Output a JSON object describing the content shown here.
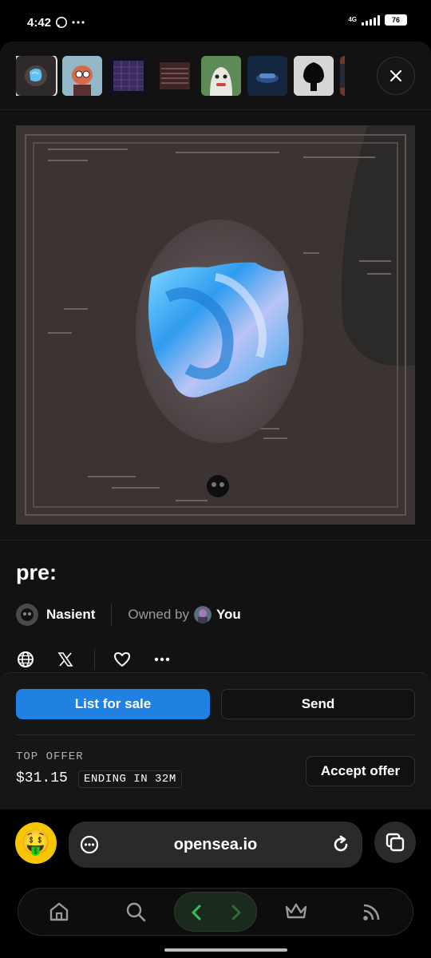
{
  "status_bar": {
    "time": "4:42",
    "extra": "•••",
    "network": "4G",
    "battery": "76"
  },
  "thumbnails": [
    {
      "name": "thumb-pre-cube",
      "active": true,
      "color": "#2e2a2a"
    },
    {
      "name": "thumb-cartoon-pig",
      "active": false,
      "color": "#93b9c9"
    },
    {
      "name": "thumb-purple-grid",
      "active": false,
      "color": "#1c1530"
    },
    {
      "name": "thumb-red-lines",
      "active": false,
      "color": "#1a1414"
    },
    {
      "name": "thumb-green-face",
      "active": false,
      "color": "#5d8a55"
    },
    {
      "name": "thumb-blue-car",
      "active": false,
      "color": "#1b3050"
    },
    {
      "name": "thumb-black-tree",
      "active": false,
      "color": "#d6d6d6"
    },
    {
      "name": "thumb-partial",
      "active": false,
      "color": "#6b3b2b"
    }
  ],
  "nft": {
    "title": "pre:",
    "creator": "Nasient",
    "owned_by_label": "Owned by",
    "owner": "You"
  },
  "actions": {
    "list_for_sale": "List for sale",
    "send": "Send",
    "top_offer_label": "TOP OFFER",
    "top_offer_price": "$31.15",
    "ending": "ENDING IN 32M",
    "accept_offer": "Accept offer"
  },
  "browser": {
    "url": "opensea.io",
    "emoji": "🤑"
  },
  "colors": {
    "accent_blue": "#2081e2",
    "sheet_bg": "#121212",
    "emoji_bg": "#f6c700"
  },
  "icons": [
    "globe-icon",
    "x-logo-icon",
    "heart-icon",
    "more-icon",
    "close-icon",
    "menu-dots-icon",
    "reload-icon",
    "tabs-icon",
    "home-icon",
    "search-icon",
    "back-icon",
    "forward-icon",
    "crown-icon",
    "feed-icon"
  ]
}
